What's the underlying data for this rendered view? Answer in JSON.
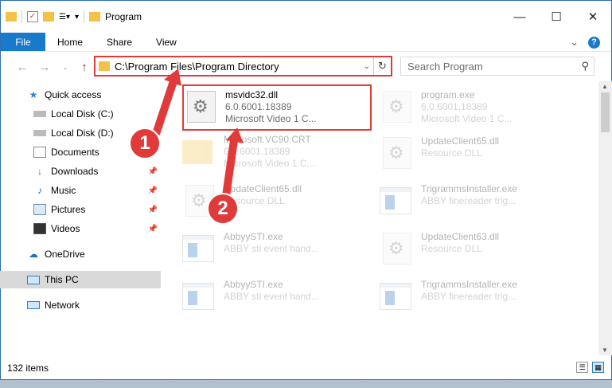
{
  "window": {
    "title": "Program",
    "controls": {
      "minimize": "—",
      "maximize": "☐",
      "close": "✕"
    }
  },
  "ribbon": {
    "tabs": [
      "File",
      "Home",
      "Share",
      "View"
    ],
    "expand_glyph": "⌄",
    "help_glyph": "?"
  },
  "address": {
    "path": "C:\\Program Files\\Program Directory",
    "search_placeholder": "Search Program"
  },
  "nav": {
    "items": [
      {
        "label": "Quick access",
        "icon": "star-icon"
      },
      {
        "label": "Local Disk (C:)",
        "icon": "drive-icon"
      },
      {
        "label": "Local Disk (D:)",
        "icon": "drive-icon"
      },
      {
        "label": "Documents",
        "icon": "documents-icon"
      },
      {
        "label": "Downloads",
        "icon": "download-icon"
      },
      {
        "label": "Music",
        "icon": "music-icon"
      },
      {
        "label": "Pictures",
        "icon": "pictures-icon"
      },
      {
        "label": "Videos",
        "icon": "videos-icon"
      },
      {
        "label": "OneDrive",
        "icon": "cloud-icon"
      },
      {
        "label": "This PC",
        "icon": "pc-icon"
      },
      {
        "label": "Network",
        "icon": "network-icon"
      }
    ]
  },
  "files": [
    {
      "name": "msvidc32.dll",
      "line2": "6.0.6001.18389",
      "line3": "Microsoft Video 1 C...",
      "icon": "dll-gear-icon"
    },
    {
      "name": "program.exe",
      "line2": "6.0.6001.18389",
      "line3": "Microsoft Video 1 C...",
      "icon": "setup-exe-icon"
    },
    {
      "name": "Microsoft.VC90.CRT",
      "line2": "6.0.6001.18389",
      "line3": "Microsoft Video 1 C...",
      "icon": "folder-icon"
    },
    {
      "name": "UpdateClient65.dll",
      "line2": "Resource DLL",
      "line3": "",
      "icon": "dll-gear-icon"
    },
    {
      "name": "UpdateClient65.dll",
      "line2": "Resource DLL",
      "line3": "",
      "icon": "dll-gear-icon"
    },
    {
      "name": "TrigrammsInstaller.exe",
      "line2": "ABBY finereader trig...",
      "line3": "",
      "icon": "exe-window-icon"
    },
    {
      "name": "AbbyySTI.exe",
      "line2": "ABBY sti event hand...",
      "line3": "",
      "icon": "exe-window-icon"
    },
    {
      "name": "UpdateClient63.dll",
      "line2": "Resource DLL",
      "line3": "",
      "icon": "dll-gear-icon"
    },
    {
      "name": "AbbyySTI.exe",
      "line2": "ABBY sti event hand...",
      "line3": "",
      "icon": "exe-window-icon"
    },
    {
      "name": "TrigrammsInstaller.exe",
      "line2": "ABBY finereader trig...",
      "line3": "",
      "icon": "exe-window-icon"
    }
  ],
  "status": {
    "item_count": "132 items"
  },
  "callouts": [
    "1",
    "2"
  ],
  "colors": {
    "accent": "#1979ca",
    "highlight": "#e03a3a"
  }
}
